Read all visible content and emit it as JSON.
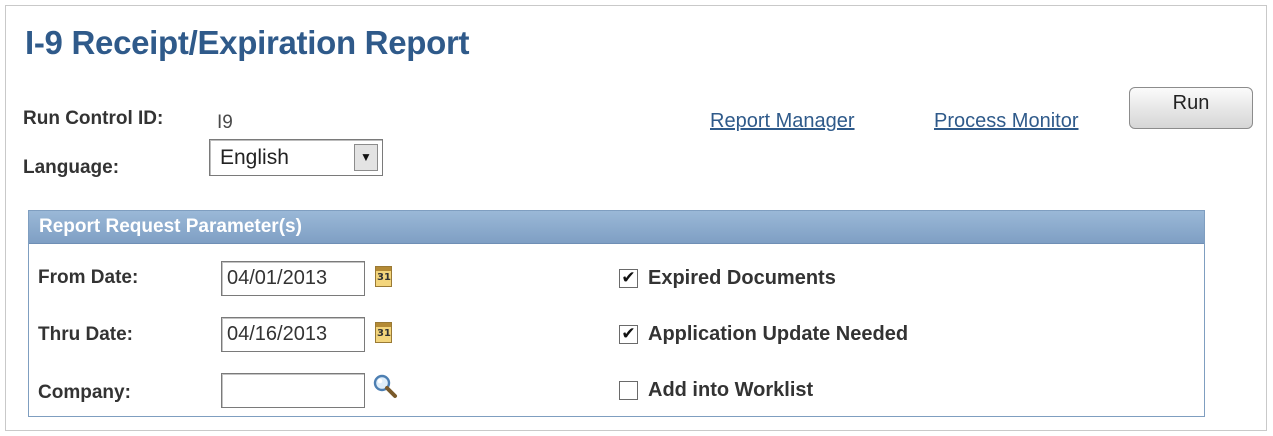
{
  "page": {
    "title": "I-9 Receipt/Expiration Report"
  },
  "run_control": {
    "label": "Run Control ID:",
    "value": "I9"
  },
  "language": {
    "label": "Language:",
    "selected": "English"
  },
  "links": {
    "report_manager": "Report Manager",
    "process_monitor": "Process Monitor"
  },
  "run_button": {
    "label": "Run"
  },
  "params": {
    "title": "Report Request Parameter(s)",
    "from_date": {
      "label": "From Date:",
      "value": "04/01/2013"
    },
    "thru_date": {
      "label": "Thru Date:",
      "value": "04/16/2013"
    },
    "company": {
      "label": "Company:",
      "value": ""
    },
    "calendar_day": "31",
    "checkboxes": [
      {
        "label": "Expired Documents",
        "checked": true
      },
      {
        "label": "Application Update Needed",
        "checked": true
      },
      {
        "label": "Add into Worklist",
        "checked": false
      }
    ]
  },
  "colors": {
    "title": "#2f5a8a",
    "group_header": "#8aa9cc",
    "link": "#2f5a8a"
  },
  "icons": {
    "calendar": "calendar-icon",
    "lookup": "magnifier-icon",
    "dropdown": "dropdown-arrow-icon"
  }
}
